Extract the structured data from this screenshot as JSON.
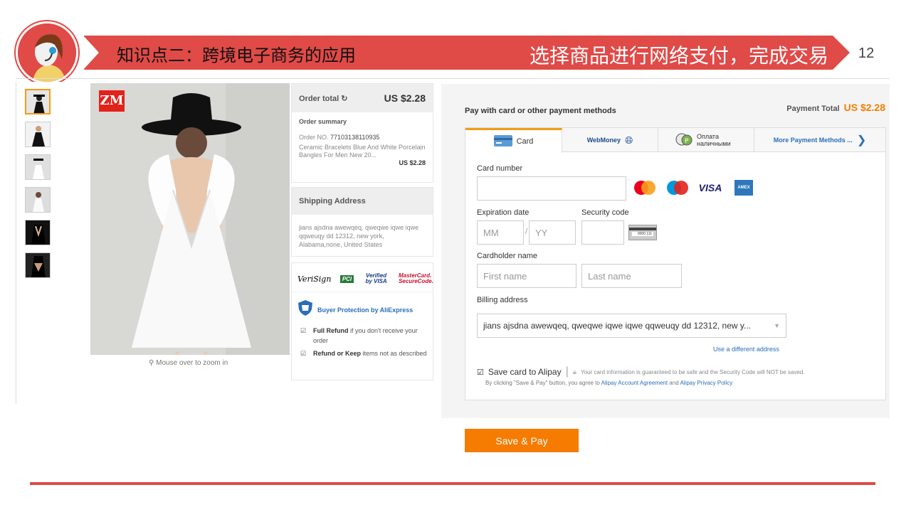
{
  "slide": {
    "title": "知识点二：跨境电子商务的应用",
    "subtitle": "选择商品进行网络支付，完成交易",
    "page_number": "12"
  },
  "product": {
    "brand_badge": "ZM",
    "zoom_hint": "Mouse over to zoom in"
  },
  "order": {
    "total_label": "Order total",
    "total_value": "US $2.28",
    "summary_label": "Order summary",
    "order_no_label": "Order NO.",
    "order_no": "77103138110935",
    "item_desc": "Ceramic Bracelets Blue And White Porcelain Bangles For Men New 20...",
    "item_price": "US $2.28"
  },
  "shipping": {
    "label": "Shipping Address",
    "address": "jians ajsdna awewqeq, qweqwe iqwe iqwe qqweuqy dd 12312, new york, Alabama,none, United States"
  },
  "security": {
    "verisign": "VeriSign",
    "pci": "PCI",
    "verified_visa": "Verified by VISA",
    "mastercard": "MasterCard. SecureCode.",
    "protection_title": "Buyer Protection by AliExpress",
    "item1_bold": "Full Refund",
    "item1_text": " if you don't receive your order",
    "item2_bold": "Refund or Keep",
    "item2_text": " items not as described"
  },
  "payment": {
    "heading": "Pay with card or other payment methods",
    "total_label": "Payment Total",
    "total_value": "US $2.28",
    "tabs": [
      "Card",
      "WebMoney",
      "Оплата наличными",
      "More Payment Methods ..."
    ],
    "card_number_label": "Card number",
    "brands": [
      "MasterCard",
      "Maestro",
      "VISA",
      "AMEX"
    ],
    "expiration_label": "Expiration date",
    "mm_placeholder": "MM",
    "yy_placeholder": "YY",
    "security_label": "Security code",
    "cvv_sample": "0000 111",
    "cardholder_label": "Cardholder name",
    "first_placeholder": "First name",
    "last_placeholder": "Last name",
    "billing_label": "Billing address",
    "billing_value": "jians ajsdna awewqeq, qweqwe iqwe iqwe qqweuqy dd 12312, new y...",
    "different_address": "Use a different address",
    "save_card": "Save card to Alipay",
    "secure_note": "Your card information is guaranteed to be safe and the Security Code will NOT be saved.",
    "agree_text": "By clicking \"Save & Pay\" button, you agree to",
    "agreement_link": "Alipay Account Agreement",
    "and": "and",
    "privacy_link": "Alipay Privacy Policy",
    "save_pay_button": "Save & Pay"
  },
  "colors": {
    "accent": "#e04a47",
    "orange": "#f57c00",
    "price": "#f57c00"
  }
}
